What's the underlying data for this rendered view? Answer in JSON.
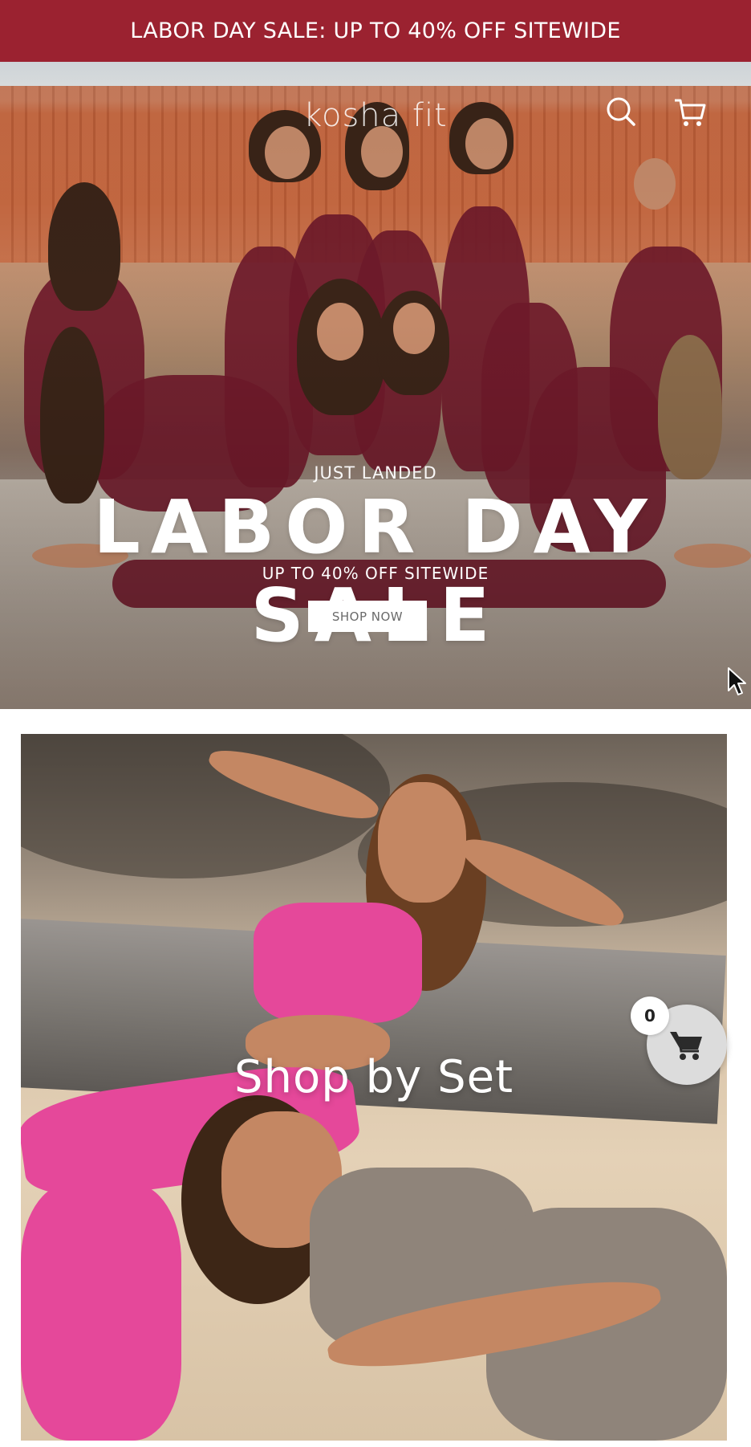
{
  "announcement": {
    "text": "LABOR DAY SALE: UP TO 40% OFF SITEWIDE"
  },
  "header": {
    "logo_text": "kosha fit",
    "icons": [
      "search-icon",
      "cart-icon"
    ]
  },
  "hero": {
    "kicker": "JUST LANDED",
    "headline": "LABOR DAY SALE",
    "subline": "UP TO 40% OFF SITEWIDE",
    "cta_label": "SHOP NOW"
  },
  "collection": {
    "title": "Shop by Set"
  },
  "floating_cart": {
    "count": "0",
    "icon": "cart-icon"
  },
  "colors": {
    "announcement_bg": "#9b2230",
    "accent_wine": "#6e1a2a",
    "pink": "#e5489a"
  }
}
